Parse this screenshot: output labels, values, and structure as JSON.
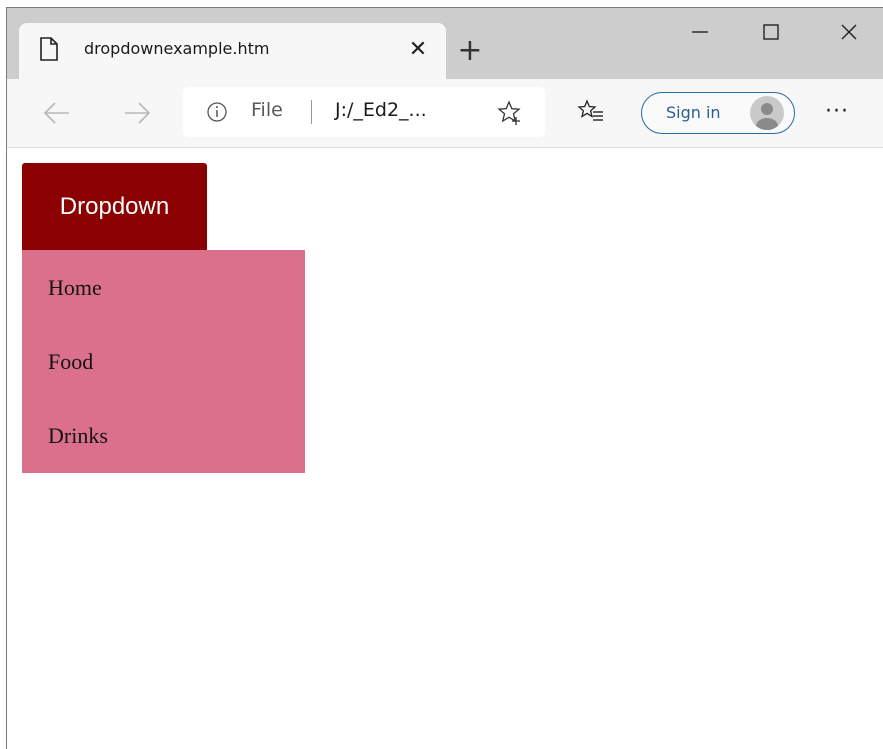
{
  "browser": {
    "tab": {
      "title": "dropdownexample.htm",
      "close_glyph": "✕",
      "icon": "document-icon"
    },
    "new_tab_glyph": "+",
    "window_controls": {
      "minimize": "minimize-icon",
      "maximize": "maximize-icon",
      "close": "close-icon"
    },
    "toolbar": {
      "scheme": "File",
      "url": "J:/_Ed2_...",
      "signin_label": "Sign in",
      "more_glyph": "···"
    }
  },
  "page": {
    "dropdown_label": "Dropdown",
    "menu_items": [
      "Home",
      "Food",
      "Drinks"
    ],
    "colors": {
      "button": "#8b0000",
      "menu": "#db708d",
      "button_text": "#ffffff"
    }
  }
}
